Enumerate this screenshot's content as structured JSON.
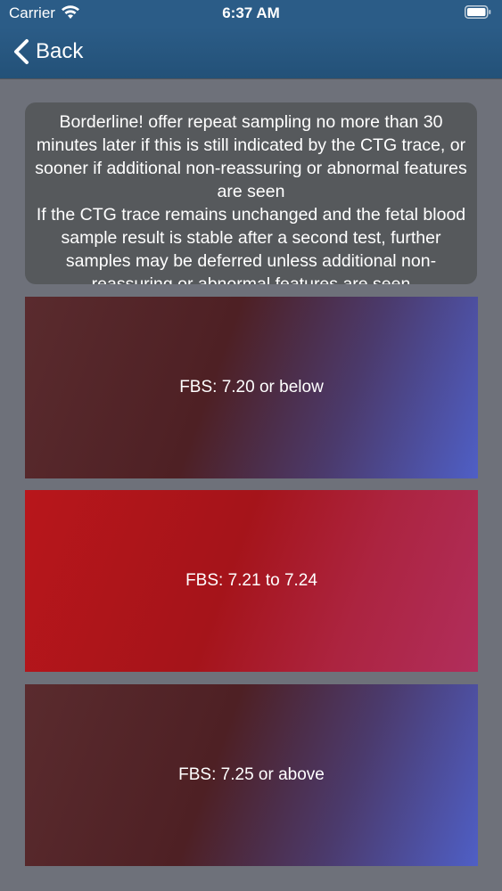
{
  "status_bar": {
    "carrier": "Carrier",
    "time": "6:37 AM",
    "wifi_icon": "wifi-icon",
    "battery_icon": "battery-icon"
  },
  "nav": {
    "back_label": "Back",
    "back_icon": "chevron-left-icon"
  },
  "message": {
    "paragraph_1": "Borderline! offer repeat sampling no more than 30 minutes later if this is still indicated by the CTG trace, or sooner if additional non-reassuring or abnormal features are seen",
    "paragraph_2": "If the CTG trace remains unchanged and the fetal blood sample result is stable after a second test, further samples may be deferred unless additional non-reassuring or abnormal features are seen"
  },
  "options": [
    {
      "label": "FBS: 7.20 or below"
    },
    {
      "label": "FBS: 7.21 to 7.24"
    },
    {
      "label": "FBS: 7.25 or above"
    }
  ],
  "colors": {
    "nav_background": "#2b5c87",
    "page_background": "#6e717a",
    "message_background": "#56595c",
    "card_dark": "#4e2024",
    "card_blue": "#4f5fc6",
    "card_red": "#b8161b"
  }
}
